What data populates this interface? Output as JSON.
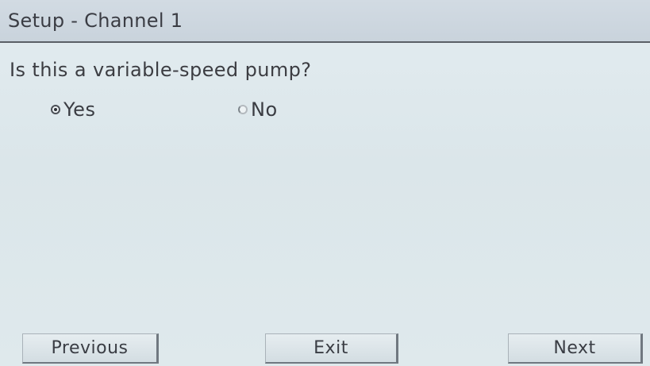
{
  "header": {
    "title": "Setup - Channel 1"
  },
  "question": {
    "text": "Is this a variable-speed pump?",
    "options": [
      {
        "label": "Yes",
        "selected": true
      },
      {
        "label": "No",
        "selected": false
      }
    ]
  },
  "footer": {
    "previous_label": "Previous",
    "exit_label": "Exit",
    "next_label": "Next"
  }
}
